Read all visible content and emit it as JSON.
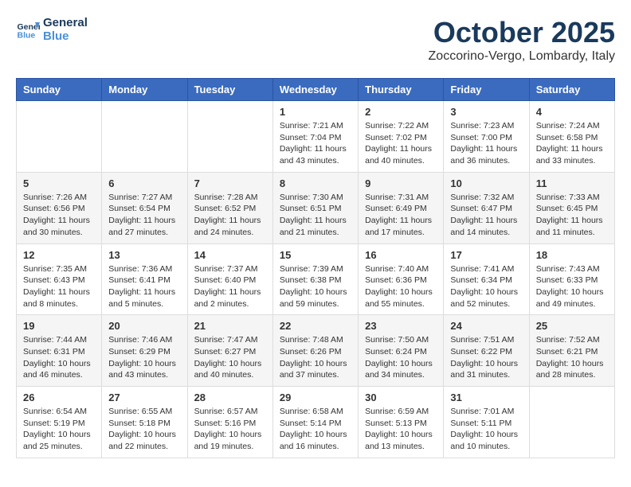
{
  "header": {
    "logo_line1": "General",
    "logo_line2": "Blue",
    "month": "October 2025",
    "location": "Zoccorino-Vergo, Lombardy, Italy"
  },
  "days_of_week": [
    "Sunday",
    "Monday",
    "Tuesday",
    "Wednesday",
    "Thursday",
    "Friday",
    "Saturday"
  ],
  "weeks": [
    [
      {
        "day": "",
        "info": ""
      },
      {
        "day": "",
        "info": ""
      },
      {
        "day": "",
        "info": ""
      },
      {
        "day": "1",
        "info": "Sunrise: 7:21 AM\nSunset: 7:04 PM\nDaylight: 11 hours and 43 minutes."
      },
      {
        "day": "2",
        "info": "Sunrise: 7:22 AM\nSunset: 7:02 PM\nDaylight: 11 hours and 40 minutes."
      },
      {
        "day": "3",
        "info": "Sunrise: 7:23 AM\nSunset: 7:00 PM\nDaylight: 11 hours and 36 minutes."
      },
      {
        "day": "4",
        "info": "Sunrise: 7:24 AM\nSunset: 6:58 PM\nDaylight: 11 hours and 33 minutes."
      }
    ],
    [
      {
        "day": "5",
        "info": "Sunrise: 7:26 AM\nSunset: 6:56 PM\nDaylight: 11 hours and 30 minutes."
      },
      {
        "day": "6",
        "info": "Sunrise: 7:27 AM\nSunset: 6:54 PM\nDaylight: 11 hours and 27 minutes."
      },
      {
        "day": "7",
        "info": "Sunrise: 7:28 AM\nSunset: 6:52 PM\nDaylight: 11 hours and 24 minutes."
      },
      {
        "day": "8",
        "info": "Sunrise: 7:30 AM\nSunset: 6:51 PM\nDaylight: 11 hours and 21 minutes."
      },
      {
        "day": "9",
        "info": "Sunrise: 7:31 AM\nSunset: 6:49 PM\nDaylight: 11 hours and 17 minutes."
      },
      {
        "day": "10",
        "info": "Sunrise: 7:32 AM\nSunset: 6:47 PM\nDaylight: 11 hours and 14 minutes."
      },
      {
        "day": "11",
        "info": "Sunrise: 7:33 AM\nSunset: 6:45 PM\nDaylight: 11 hours and 11 minutes."
      }
    ],
    [
      {
        "day": "12",
        "info": "Sunrise: 7:35 AM\nSunset: 6:43 PM\nDaylight: 11 hours and 8 minutes."
      },
      {
        "day": "13",
        "info": "Sunrise: 7:36 AM\nSunset: 6:41 PM\nDaylight: 11 hours and 5 minutes."
      },
      {
        "day": "14",
        "info": "Sunrise: 7:37 AM\nSunset: 6:40 PM\nDaylight: 11 hours and 2 minutes."
      },
      {
        "day": "15",
        "info": "Sunrise: 7:39 AM\nSunset: 6:38 PM\nDaylight: 10 hours and 59 minutes."
      },
      {
        "day": "16",
        "info": "Sunrise: 7:40 AM\nSunset: 6:36 PM\nDaylight: 10 hours and 55 minutes."
      },
      {
        "day": "17",
        "info": "Sunrise: 7:41 AM\nSunset: 6:34 PM\nDaylight: 10 hours and 52 minutes."
      },
      {
        "day": "18",
        "info": "Sunrise: 7:43 AM\nSunset: 6:33 PM\nDaylight: 10 hours and 49 minutes."
      }
    ],
    [
      {
        "day": "19",
        "info": "Sunrise: 7:44 AM\nSunset: 6:31 PM\nDaylight: 10 hours and 46 minutes."
      },
      {
        "day": "20",
        "info": "Sunrise: 7:46 AM\nSunset: 6:29 PM\nDaylight: 10 hours and 43 minutes."
      },
      {
        "day": "21",
        "info": "Sunrise: 7:47 AM\nSunset: 6:27 PM\nDaylight: 10 hours and 40 minutes."
      },
      {
        "day": "22",
        "info": "Sunrise: 7:48 AM\nSunset: 6:26 PM\nDaylight: 10 hours and 37 minutes."
      },
      {
        "day": "23",
        "info": "Sunrise: 7:50 AM\nSunset: 6:24 PM\nDaylight: 10 hours and 34 minutes."
      },
      {
        "day": "24",
        "info": "Sunrise: 7:51 AM\nSunset: 6:22 PM\nDaylight: 10 hours and 31 minutes."
      },
      {
        "day": "25",
        "info": "Sunrise: 7:52 AM\nSunset: 6:21 PM\nDaylight: 10 hours and 28 minutes."
      }
    ],
    [
      {
        "day": "26",
        "info": "Sunrise: 6:54 AM\nSunset: 5:19 PM\nDaylight: 10 hours and 25 minutes."
      },
      {
        "day": "27",
        "info": "Sunrise: 6:55 AM\nSunset: 5:18 PM\nDaylight: 10 hours and 22 minutes."
      },
      {
        "day": "28",
        "info": "Sunrise: 6:57 AM\nSunset: 5:16 PM\nDaylight: 10 hours and 19 minutes."
      },
      {
        "day": "29",
        "info": "Sunrise: 6:58 AM\nSunset: 5:14 PM\nDaylight: 10 hours and 16 minutes."
      },
      {
        "day": "30",
        "info": "Sunrise: 6:59 AM\nSunset: 5:13 PM\nDaylight: 10 hours and 13 minutes."
      },
      {
        "day": "31",
        "info": "Sunrise: 7:01 AM\nSunset: 5:11 PM\nDaylight: 10 hours and 10 minutes."
      },
      {
        "day": "",
        "info": ""
      }
    ]
  ]
}
